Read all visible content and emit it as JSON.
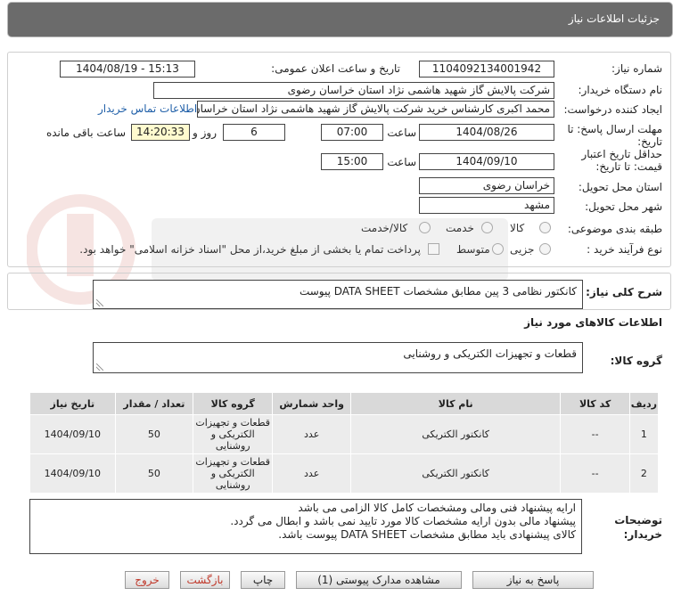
{
  "header": {
    "title": "جزئیات اطلاعات نیاز"
  },
  "form": {
    "need_number_label": "شماره نیاز:",
    "need_number": "1104092134001942",
    "announce_label": "تاریخ و ساعت اعلان عمومی:",
    "announce_value": "1404/08/19 - 15:13",
    "buyer_label": "نام دستگاه خریدار:",
    "buyer_value": "شرکت پالایش گاز شهید هاشمی نژاد   استان خراسان رضوی",
    "creator_label": "ایجاد کننده درخواست:",
    "creator_value": "محمد اکبری کارشناس خرید شرکت پالایش گاز شهید هاشمی نژاد   استان خراسان رضوی",
    "contact_link": "اطلاعات تماس خریدار",
    "deadline_label": "مهلت ارسال پاسخ: تا تاریخ:",
    "deadline_date": "1404/08/26",
    "time_label": "ساعت",
    "deadline_time": "07:00",
    "days_value": "6",
    "days_label": "روز و",
    "remaining_value": "14:20:33",
    "remaining_label": "ساعت باقی مانده",
    "validity_label": "حداقل تاریخ اعتبار قیمت: تا تاریخ:",
    "validity_date": "1404/09/10",
    "validity_time": "15:00",
    "province_label": "استان محل تحویل:",
    "province_value": "خراسان رضوی",
    "city_label": "شهر محل تحویل:",
    "city_value": "مشهد",
    "category_label": "طبقه بندی موضوعی:",
    "category_options": [
      "کالا",
      "خدمت",
      "کالا/خدمت"
    ],
    "process_label": "نوع فرآیند خرید :",
    "process_options": [
      "جزیی",
      "متوسط"
    ],
    "payment_note": "پرداخت تمام یا بخشی از مبلغ خرید،از محل \"اسناد خزانه اسلامی\" خواهد بود."
  },
  "summary": {
    "label": "شرح کلی نیاز:",
    "value": "کانکتور نظامی 3 پین مطابق مشخصات DATA SHEET پیوست"
  },
  "goods": {
    "section_title": "اطلاعات کالاهای مورد نیاز",
    "group_label": "گروه کالا:",
    "group_value": "قطعات و تجهیزات الکتریکی و روشنایی"
  },
  "table": {
    "headers": [
      "ردیف",
      "کد کالا",
      "نام کالا",
      "واحد شمارش",
      "گروه کالا",
      "تعداد / مقدار",
      "تاریخ نیاز"
    ],
    "rows": [
      [
        "1",
        "--",
        "کانکتور الکتریکی",
        "عدد",
        "قطعات و تجهیزات الکتریکی و روشنایی",
        "50",
        "1404/09/10"
      ],
      [
        "2",
        "--",
        "کانکتور الکتریکی",
        "عدد",
        "قطعات و تجهیزات الکتریکی و روشنایی",
        "50",
        "1404/09/10"
      ]
    ]
  },
  "notes": {
    "label": "توضیحات خریدار:",
    "lines": [
      "ارایه پیشنهاد فنی ومالی ومشخصات کامل کالا الزامی می باشد",
      "پیشنهاد مالی بدون ارایه مشخصات کالا مورد تایید نمی باشد و ابطال می گردد.",
      "کالای پیشنهادی باید مطابق مشخصات DATA SHEET پیوست باشد."
    ]
  },
  "buttons": {
    "reply": "پاسخ به نیاز",
    "attachments": "مشاهده مدارک پیوستی (1)",
    "print": "چاپ",
    "back": "بازگشت",
    "exit": "خروج"
  },
  "colors": {
    "header_bg": "#6b6b6b",
    "highlight": "#fffbcf",
    "link": "#1f5fa8"
  }
}
